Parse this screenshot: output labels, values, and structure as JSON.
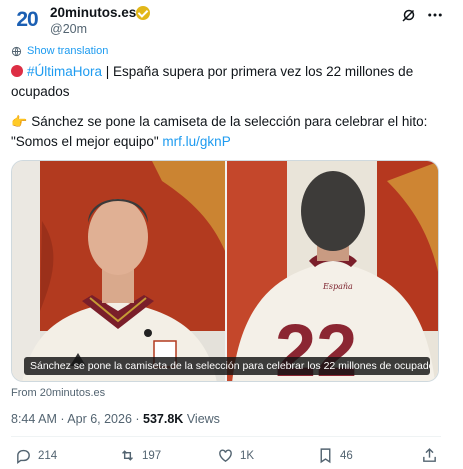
{
  "account": {
    "avatar_text": "20",
    "name": "20minutos.es",
    "handle": "@20m"
  },
  "translate": {
    "label": "Show translation"
  },
  "tweet": {
    "line1_hashtag": "#ÚltimaHora",
    "line1_text": " | España supera por primera vez los 22 millones de ocupados",
    "line2_text": "Sánchez se pone la camiseta de la selección para celebrar el hito: \"Somos el mejor equipo\" ",
    "line2_link": "mrf.lu/gknP"
  },
  "media": {
    "caption": "Sánchez se pone la camiseta de la selección para celebrar los 22 millones de ocupado...",
    "jersey_text": "España"
  },
  "source": {
    "label": "From 20minutos.es"
  },
  "meta": {
    "time": "8:44 AM · Apr 6, 2026 · ",
    "views_count": "537.8K",
    "views_label": " Views"
  },
  "actions": {
    "replies": "214",
    "reposts": "197",
    "likes": "1K",
    "bookmarks": "46"
  },
  "colors": {
    "link": "#1d9bf0",
    "text": "#0f1419",
    "muted": "#536471",
    "brand": "#1b5fb3",
    "verified": "#e2b719"
  },
  "icons": [
    "verified-badge-icon",
    "grok-icon",
    "more-icon",
    "globe-icon",
    "red-circle-emoji",
    "pointing-hand-emoji",
    "reply-icon",
    "repost-icon",
    "like-icon",
    "bookmark-icon",
    "share-icon"
  ]
}
